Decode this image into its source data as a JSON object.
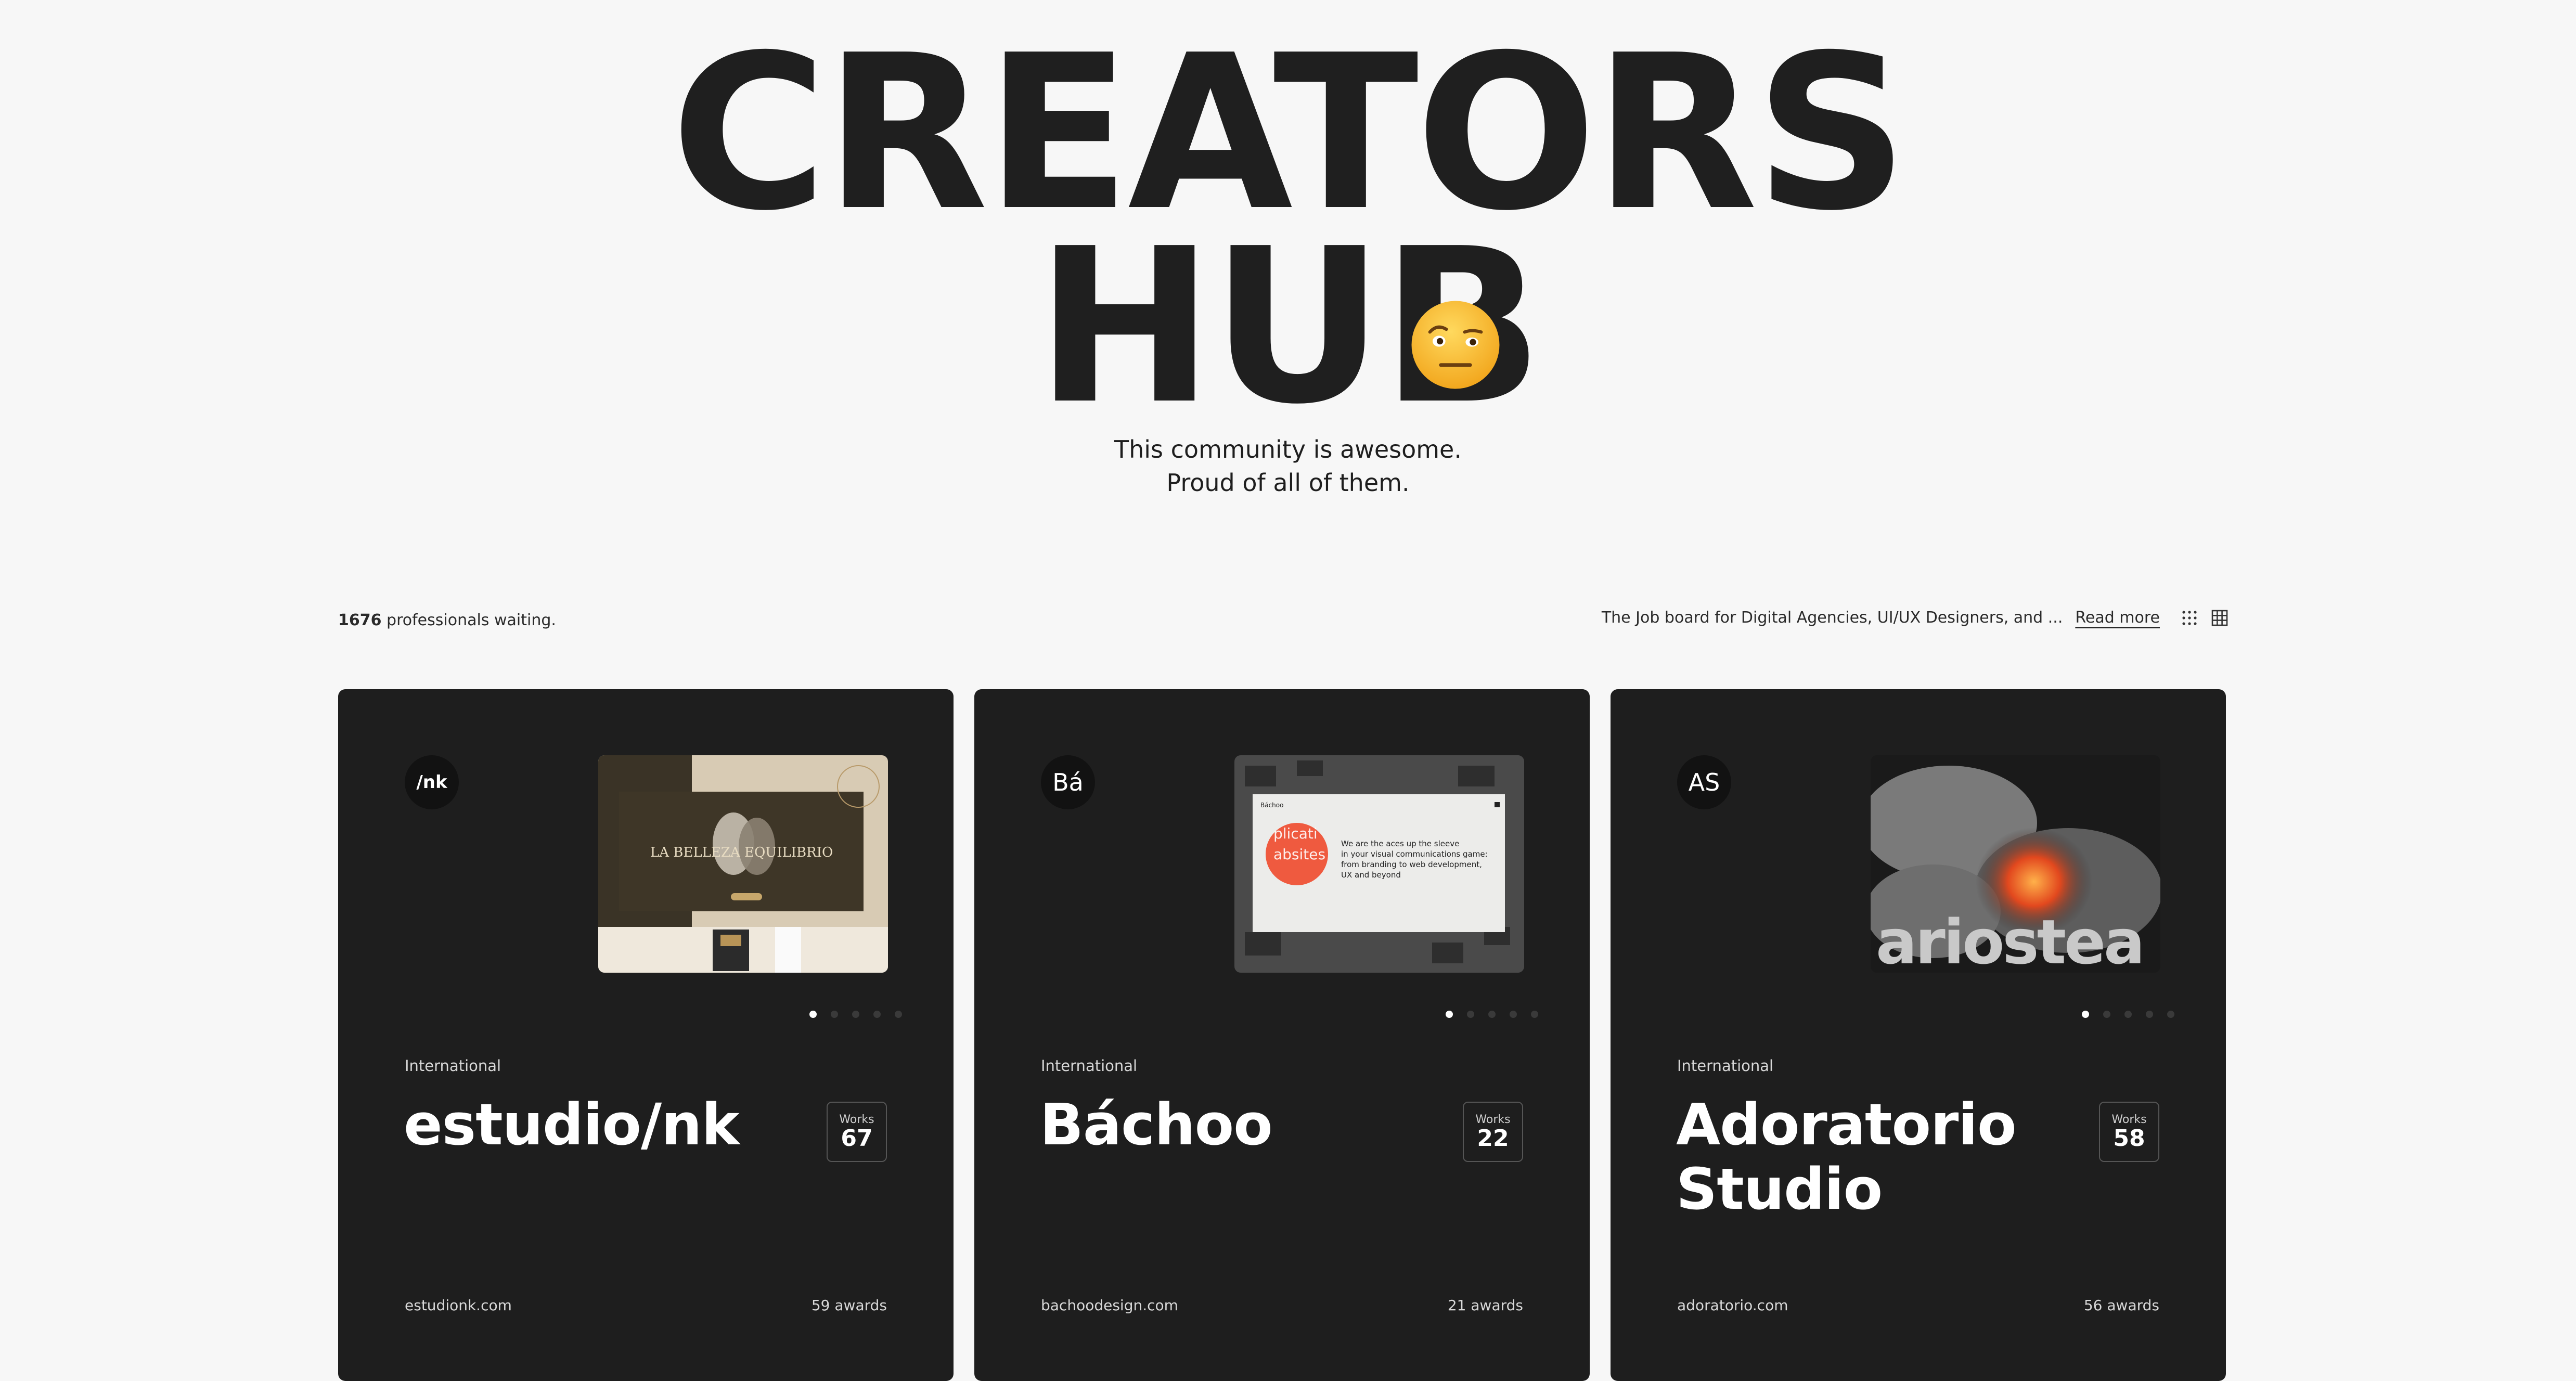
{
  "hero": {
    "title_line1": "CREATORS",
    "title_line2": "HUB",
    "subtitle_line1": "This community is awesome.",
    "subtitle_line2": "Proud of all of them."
  },
  "info_bar": {
    "count": "1676",
    "count_suffix": " professionals waiting.",
    "description": "The Job board for Digital Agencies, UI/UX Designers, and ...",
    "read_more": "Read more"
  },
  "cards": [
    {
      "logo": "/nk",
      "region": "International",
      "name": "estudio/nk",
      "works_label": "Works",
      "works": "67",
      "site": "estudionk.com",
      "awards": "59 awards",
      "thumb_text": "LA BELLEZA   EQUILIBRIO"
    },
    {
      "logo": "Bá",
      "region": "International",
      "name": "Báchoo",
      "works_label": "Works",
      "works": "22",
      "site": "bachoodesign.com",
      "awards": "21 awards",
      "thumb_text": "We are the aces up the sleeve in your visual communications game: from branding to web development, UX and beyond"
    },
    {
      "logo": "AS",
      "region": "International",
      "name": "Adoratorio Studio",
      "works_label": "Works",
      "works": "58",
      "site": "adoratorio.com",
      "awards": "56 awards",
      "thumb_text": "ariostea"
    }
  ],
  "colors": {
    "page_bg": "#f7f7f7",
    "card_bg": "#1e1e1e",
    "text_dark": "#1e1e1e",
    "emoji_yellow": "#f5b82e"
  },
  "icons": [
    "face-with-raised-eyebrow-emoji",
    "dots-grid-icon",
    "grid-icon"
  ]
}
